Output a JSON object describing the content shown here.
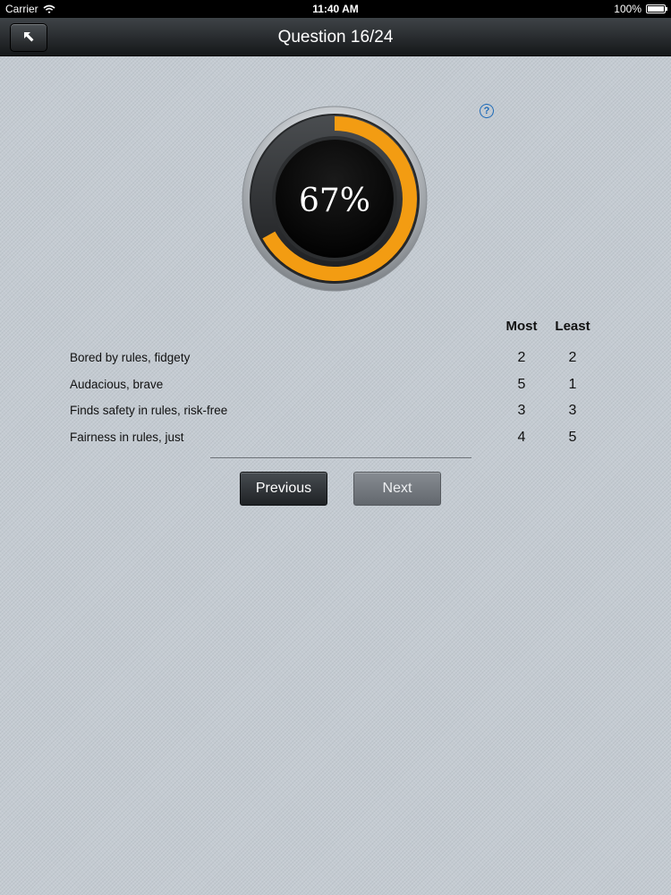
{
  "status_bar": {
    "carrier": "Carrier",
    "time": "11:40 AM",
    "battery": "100%",
    "icons": [
      "wifi-icon",
      "battery-icon"
    ]
  },
  "nav": {
    "title": "Question 16/24",
    "back_icon": "back-arrow-icon"
  },
  "help_icon": {
    "glyph": "?"
  },
  "progress": {
    "label": "67%",
    "fraction": 0.67,
    "color": "#f39c12"
  },
  "table": {
    "headers": {
      "most": "Most",
      "least": "Least"
    },
    "rows": [
      {
        "label": "Bored by rules, fidgety",
        "most": "2",
        "least": "2"
      },
      {
        "label": "Audacious, brave",
        "most": "5",
        "least": "1"
      },
      {
        "label": "Finds safety in rules, risk-free",
        "most": "3",
        "least": "3"
      },
      {
        "label": "Fairness in rules, just",
        "most": "4",
        "least": "5"
      }
    ]
  },
  "buttons": {
    "previous": "Previous",
    "next": "Next"
  }
}
